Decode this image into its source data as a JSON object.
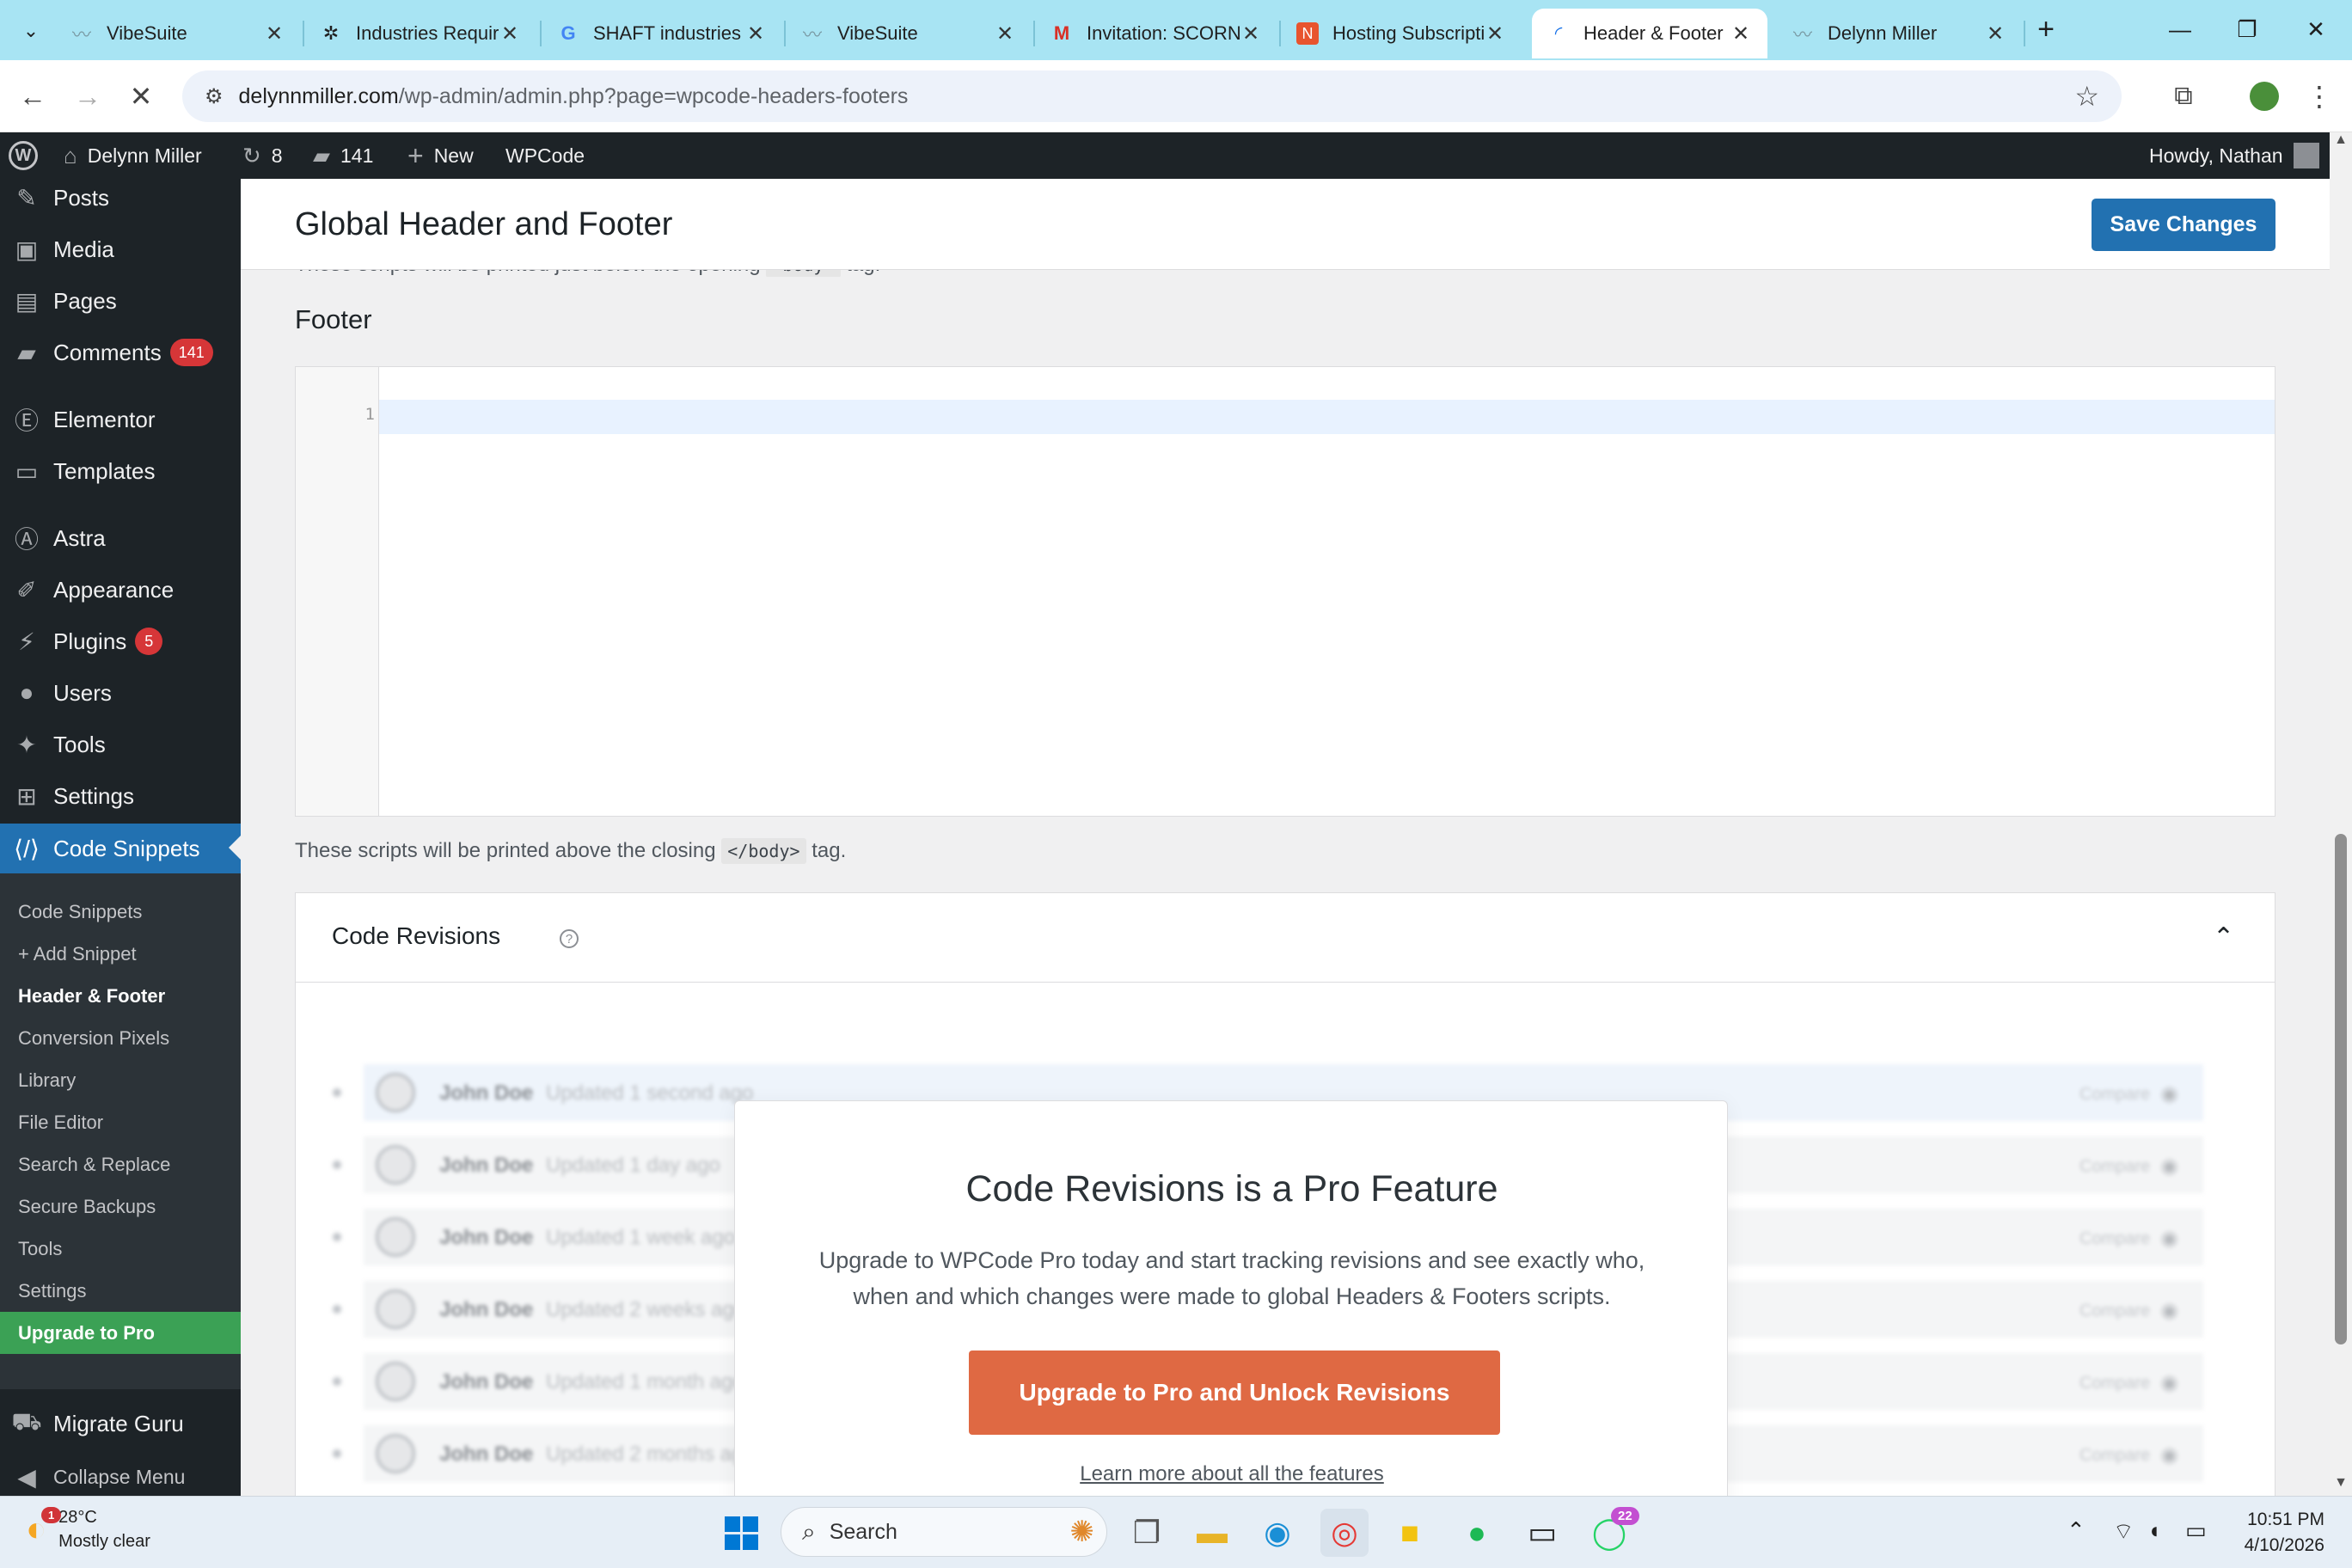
{
  "browser": {
    "tabs": [
      {
        "title": "VibeSuite",
        "icon": "vibesuite-icon"
      },
      {
        "title": "Industries Requiri",
        "icon": "openai-icon"
      },
      {
        "title": "SHAFT industries",
        "icon": "google-icon"
      },
      {
        "title": "VibeSuite",
        "icon": "vibesuite-icon"
      },
      {
        "title": "Invitation: SCORN",
        "icon": "gmail-icon"
      },
      {
        "title": "Hosting Subscripti",
        "icon": "hosting-icon"
      },
      {
        "title": "Header & Footer",
        "icon": "loading-icon",
        "active": true
      },
      {
        "title": "Delynn Miller",
        "icon": "vibesuite-icon"
      }
    ],
    "url_host": "delynnmiller.com",
    "url_path": "/wp-admin/admin.php?page=wpcode-headers-footers"
  },
  "adminbar": {
    "site_name": "Delynn Miller",
    "updates": "8",
    "comments": "141",
    "new_label": "New",
    "plugin_label": "WPCode",
    "greeting": "Howdy, Nathan"
  },
  "sidebar": {
    "items": [
      {
        "label": "Posts",
        "icon": "pushpin-icon"
      },
      {
        "label": "Media",
        "icon": "media-icon"
      },
      {
        "label": "Pages",
        "icon": "pages-icon"
      },
      {
        "label": "Comments",
        "icon": "comment-icon",
        "badge": "141"
      },
      {
        "label": "Elementor",
        "icon": "elementor-icon"
      },
      {
        "label": "Templates",
        "icon": "folder-icon"
      },
      {
        "label": "Astra",
        "icon": "astra-icon"
      },
      {
        "label": "Appearance",
        "icon": "brush-icon"
      },
      {
        "label": "Plugins",
        "icon": "plug-icon",
        "badge": "5"
      },
      {
        "label": "Users",
        "icon": "user-icon"
      },
      {
        "label": "Tools",
        "icon": "wrench-icon"
      },
      {
        "label": "Settings",
        "icon": "settings-icon"
      },
      {
        "label": "Code Snippets",
        "icon": "code-icon",
        "current": true
      }
    ],
    "submenu": [
      "Code Snippets",
      "+ Add Snippet",
      "Header & Footer",
      "Conversion Pixels",
      "Library",
      "File Editor",
      "Search & Replace",
      "Secure Backups",
      "Tools",
      "Settings",
      "Upgrade to Pro"
    ],
    "bottom": [
      {
        "label": "Migrate Guru",
        "icon": "migrate-icon"
      },
      {
        "label": "Collapse Menu",
        "icon": "collapse-icon"
      }
    ]
  },
  "page": {
    "title": "Global Header and Footer",
    "save_button": "Save Changes",
    "header_note_prefix": "These scripts will be printed just below the opening",
    "header_note_code": "<body>",
    "header_note_suffix": "tag.",
    "footer_label": "Footer",
    "line_number": "1",
    "footer_note_prefix": "These scripts will be printed above the closing",
    "footer_note_code": "</body>",
    "footer_note_suffix": "tag."
  },
  "revisions": {
    "title": "Code Revisions",
    "rows": [
      {
        "name": "John Doe",
        "time": "Updated 1 second ago"
      },
      {
        "name": "John Doe",
        "time": "Updated 1 day ago"
      },
      {
        "name": "John Doe",
        "time": "Updated 1 week ago"
      },
      {
        "name": "John Doe",
        "time": "Updated 2 weeks ago"
      },
      {
        "name": "John Doe",
        "time": "Updated 1 month ago"
      },
      {
        "name": "John Doe",
        "time": "Updated 2 months ago"
      }
    ],
    "compare_label": "Compare",
    "promo": {
      "title": "Code Revisions is a Pro Feature",
      "description": "Upgrade to WPCode Pro today and start tracking revisions and see exactly who, when and which changes were made to global Headers & Footers scripts.",
      "button": "Upgrade to Pro and Unlock Revisions",
      "link": "Learn more about all the features"
    }
  },
  "taskbar": {
    "weather_temp": "28°C",
    "weather_desc": "Mostly clear",
    "weather_badge": "1",
    "search_label": "Search",
    "whatsapp_badge": "22",
    "time": "10:51 PM",
    "date": "4/10/2026"
  },
  "colors": {
    "wp_blue": "#2271b1",
    "admin_dark": "#1d2327",
    "upgrade_green": "#3ba155",
    "promo_orange": "#df6943",
    "tab_strip": "#a8e4f3"
  }
}
